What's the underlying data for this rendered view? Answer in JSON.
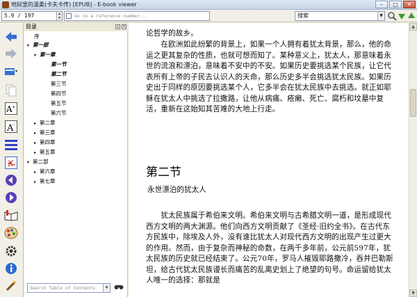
{
  "window": {
    "title": "地狱里的温柔(卡夫卡传) [EPUB] - E-book viewer",
    "controls": [
      "–",
      "□",
      "✕"
    ]
  },
  "toolbar": {
    "page_value": "5.9 / 197",
    "reference_placeholder": "Go to a reference number...",
    "search_placeholder": "搜索"
  },
  "toc": {
    "header": "目录",
    "items": [
      {
        "label": "序",
        "level": 1,
        "expanded": false,
        "arrow": ""
      },
      {
        "label": "第一部",
        "level": 0,
        "expanded": true,
        "arrow": "▾"
      },
      {
        "label": "第一章",
        "level": 1,
        "expanded": true,
        "arrow": "▾"
      },
      {
        "label": "第一节",
        "level": 2,
        "arrow": ""
      },
      {
        "label": "第二节",
        "level": 2,
        "arrow": ""
      },
      {
        "label": "第三节",
        "level": 2,
        "arrow": ""
      },
      {
        "label": "第四节",
        "level": 2,
        "arrow": ""
      },
      {
        "label": "第五节",
        "level": 2,
        "arrow": ""
      },
      {
        "label": "第六节",
        "level": 2,
        "arrow": ""
      },
      {
        "label": "第二章",
        "level": 1,
        "arrow": "▸"
      },
      {
        "label": "第三章",
        "level": 1,
        "arrow": "▸"
      },
      {
        "label": "第四章",
        "level": 1,
        "arrow": "▸"
      },
      {
        "label": "第五章",
        "level": 1,
        "arrow": "▸"
      },
      {
        "label": "第二部",
        "level": 0,
        "arrow": "▾"
      },
      {
        "label": "第六章",
        "level": 1,
        "arrow": "▸"
      },
      {
        "label": "第七章",
        "level": 1,
        "arrow": "▸"
      }
    ],
    "search_placeholder": "Search Table of Contents"
  },
  "reader": {
    "line_top": "论哲学的故乡。",
    "para1": "　　在欧洲如此纷繁的背景上，如果一个人拥有着犹太背景，那么，他的命运之更其复杂的性质，也就可想而知了。某种意义上，犹太人，那意味着永世的流浪和漂泊，意味着不安中的不安。如果历史要挑选某个民族，让它代表所有上帝的子民去认识人的天命，那么历史多半会挑选犹太民族。如果历史出于同样的原因要挑选某个人，它多半会在犹太民族中去挑选。就正如耶稣在犹太人中挑选了拉撒路，让他从病痛、疮癞、死亡、腐朽和坟墓中复活，重新在这始知其苦难的大地上行走。",
    "heading": "第二节",
    "subtitle": "永世漂泊的犹太人",
    "para2": "　　犹太民族属于希伯来文明。希伯来文明与古希腊文明一道，是形成现代西方文明的两大渊源。他们向西方文明贡献了《圣经·旧约全书》。在古代东方民族中，除埃及人外，没有谁比犹太人对现代西方文明的出现产生过更大的作用。然而，由于复杂而神秘的命数，在两千多年前，公元前597年，犹太民族的历史就已经结束了。公元70年，罗马人摧毁耶路撒冷，吞并巴勒斯坦，给古代犹太民族谩长而痛苦的乱离史划上了绝望的句号。命运留给犹太人唯一的选择：那就是"
  },
  "colors": {
    "window_bg": "#ece9d8",
    "reader_bg": "#ffffff",
    "icon_blue": "#3a6fd0",
    "icon_green": "#3a9a2a"
  }
}
